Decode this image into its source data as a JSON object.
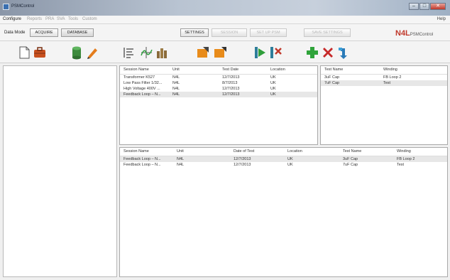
{
  "titlebar": {
    "title": "PSMControl",
    "minimize": "–",
    "maximize": "□",
    "close": "✕"
  },
  "menu": {
    "items": [
      {
        "label": "Configure",
        "active": true
      },
      {
        "label": "Reports",
        "active": false
      },
      {
        "label": "PRA",
        "active": false
      },
      {
        "label": "SVA",
        "active": false
      },
      {
        "label": "Tools",
        "active": false
      },
      {
        "label": "Custom",
        "active": false
      }
    ],
    "help": "Help"
  },
  "modebar": {
    "mode_label": "Data Mode",
    "acquire_label": "ACQUIRE",
    "database_label": "DATABASE",
    "settings_label": "SETTINGS",
    "session_label": "SESSION",
    "setup_label": "SET UP PSM",
    "save_settings_label": "SAVE SETTINGS"
  },
  "brand": {
    "name": "N4L",
    "product": "PSMControl"
  },
  "toolbar": {
    "icons": [
      "new-document-icon",
      "open-folder-icon",
      "database-icon",
      "edit-pencil-icon",
      "list-icon",
      "graph-icon",
      "bar-chart-icon",
      "import-icon",
      "export-icon",
      "run-test-icon",
      "stop-test-icon",
      "add-icon",
      "delete-icon",
      "refresh-icon"
    ]
  },
  "sessions": {
    "columns": [
      "Session Name",
      "Unit",
      "Test Date",
      "Location"
    ],
    "rows": [
      [
        "Transformer K527",
        "N4L",
        "12/7/2013",
        "UK"
      ],
      [
        "Low Pass Filter 1/32...",
        "N4L",
        "8/7/2013",
        "UK"
      ],
      [
        "High Voltage 400V ...",
        "N4L",
        "12/7/2013",
        "UK"
      ],
      [
        "Feedback Loop – N...",
        "N4L",
        "12/7/2013",
        "UK"
      ]
    ],
    "selected_index": 3
  },
  "tests": {
    "columns": [
      "Test Name",
      "Winding"
    ],
    "rows": [
      [
        "3uF Cap",
        "FB Loop 2"
      ],
      [
        "7uF Cap",
        "Test"
      ]
    ],
    "selected_index": 1
  },
  "results": {
    "columns": [
      "Session Name",
      "Unit",
      "Date of Test",
      "Location",
      "Test Name",
      "Winding"
    ],
    "rows": [
      [
        "Feedback Loop – N...",
        "N4L",
        "12/7/2013",
        "UK",
        "3uF Cap",
        "FB Loop 2"
      ],
      [
        "Feedback Loop – N...",
        "N4L",
        "12/7/2013",
        "UK",
        "7uF Cap",
        "Test"
      ]
    ],
    "selected_index": 0
  }
}
